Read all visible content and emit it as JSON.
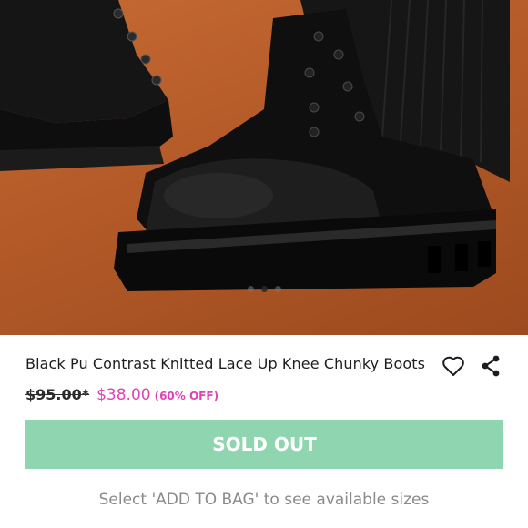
{
  "product": {
    "title": "Black Pu Contrast Knitted Lace Up Knee Chunky Boots",
    "original_price": "$95.00*",
    "sale_price": "$38.00",
    "discount": "(60% OFF)"
  },
  "actions": {
    "like_icon": "heart-icon",
    "share_icon": "share-icon",
    "primary_button": "SOLD OUT"
  },
  "size_hint": "Select 'ADD TO BAG' to see available sizes",
  "carousel": {
    "total": 3,
    "active_index": 1
  },
  "colors": {
    "accent": "#e043b4",
    "button": "#8fd6b0",
    "background_photo": "#b45a28"
  }
}
